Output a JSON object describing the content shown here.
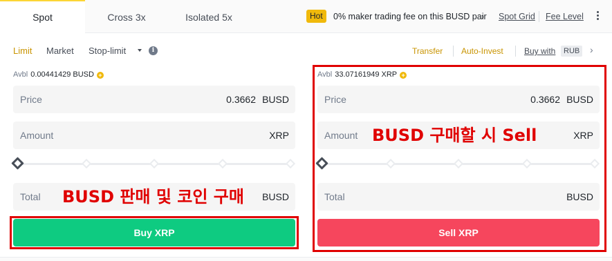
{
  "tabs": [
    {
      "label": "Spot",
      "active": true
    },
    {
      "label": "Cross 3x",
      "active": false
    },
    {
      "label": "Isolated 5x",
      "active": false
    }
  ],
  "promo": {
    "badge": "Hot",
    "text": "0% maker trading fee on this BUSD pair",
    "chevron": "›",
    "links": [
      "Spot Grid",
      "Fee Level"
    ],
    "more_icon": "kebab-vertical-icon"
  },
  "order_types": {
    "items": [
      "Limit",
      "Market",
      "Stop-limit"
    ],
    "active": "Limit",
    "info_icon": "i"
  },
  "right_links": {
    "transfer": "Transfer",
    "auto_invest": "Auto-Invest",
    "buy_with": "Buy with",
    "currency": "RUB",
    "chevron": "›"
  },
  "buy": {
    "avbl_label": "Avbl",
    "avbl_value": "0.00441429 BUSD",
    "price": {
      "label": "Price",
      "value": "0.3662",
      "unit": "BUSD"
    },
    "amount": {
      "label": "Amount",
      "value": "",
      "unit": "XRP"
    },
    "total": {
      "label": "Total",
      "value": "",
      "unit": "BUSD"
    },
    "button": "Buy XRP",
    "slider_percent": 0
  },
  "sell": {
    "avbl_label": "Avbl",
    "avbl_value": "33.07161949 XRP",
    "price": {
      "label": "Price",
      "value": "0.3662",
      "unit": "BUSD"
    },
    "amount": {
      "label": "Amount",
      "value": "",
      "unit": "XRP"
    },
    "total": {
      "label": "Total",
      "value": "",
      "unit": "BUSD"
    },
    "button": "Sell XRP",
    "slider_percent": 0
  },
  "annotations": {
    "buy_note": "BUSD 판매 및 코인 구매",
    "sell_note": "BUSD 구매할 시 Sell",
    "color": "#e00000"
  },
  "colors": {
    "buy": "#0ecb81",
    "sell": "#f6465d",
    "accent": "#f0b90b",
    "active_link": "#c99400"
  }
}
